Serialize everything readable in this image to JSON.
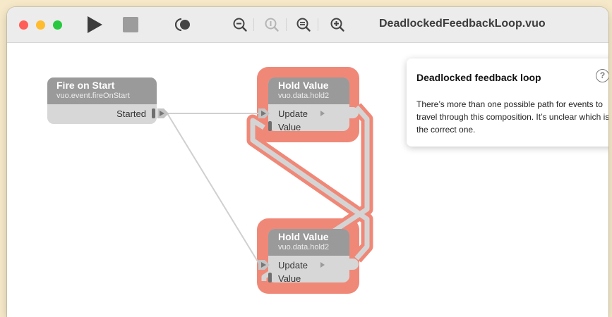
{
  "window": {
    "title": "DeadlockedFeedbackLoop.vuo",
    "traffic_lights": {
      "close": "#ff5f57",
      "minimize": "#febc2e",
      "zoom": "#28c840"
    }
  },
  "toolbar": {
    "icons": [
      "run-icon",
      "stop-icon",
      "show-events-icon",
      "zoom-out-icon",
      "zoom-actual-size-icon",
      "zoom-to-fit-icon",
      "zoom-in-icon"
    ]
  },
  "nodes": {
    "fire_on_start": {
      "title": "Fire on Start",
      "class": "vuo.event.fireOnStart",
      "ports": {
        "output": "Started"
      }
    },
    "hold_top": {
      "title": "Hold Value",
      "class": "vuo.data.hold2",
      "ports": {
        "update": "Update",
        "value": "Value"
      }
    },
    "hold_bottom": {
      "title": "Hold Value",
      "class": "vuo.data.hold2",
      "ports": {
        "update": "Update",
        "value": "Value"
      }
    }
  },
  "popover": {
    "title": "Deadlocked feedback loop",
    "help": "?",
    "body": "There’s more than one possible path for events to travel through this composition. It’s unclear which is the correct one."
  },
  "colors": {
    "highlight": "#f08878",
    "node_header": "#9a9a9a",
    "node_body": "#d7d7d7",
    "wire": "#cfcfcf",
    "background": "#f6e9c9"
  }
}
